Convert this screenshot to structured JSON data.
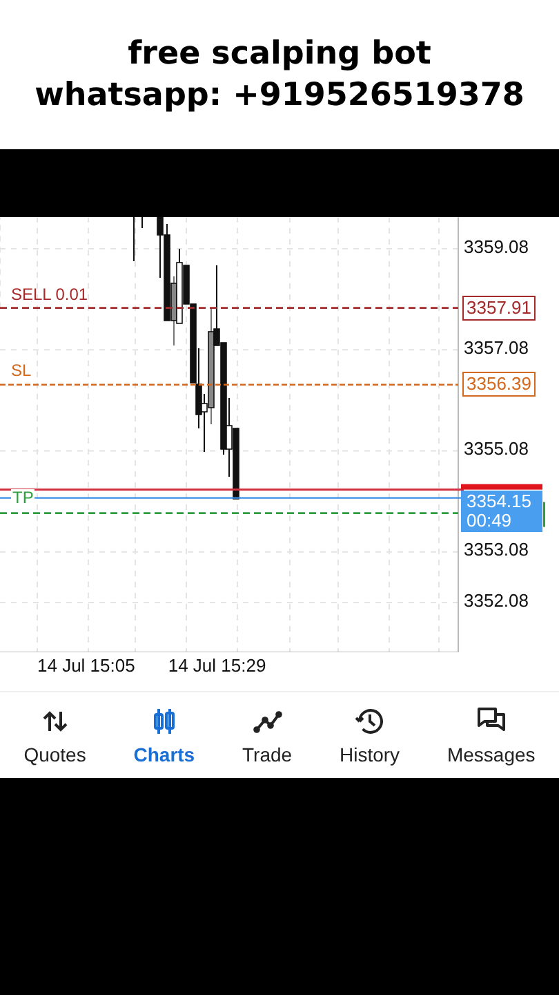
{
  "banner": {
    "lines": [
      "free scalping bot",
      "whatsapp: +919526519378"
    ]
  },
  "chart": {
    "price_ticks": [
      "3359.08",
      "3357.08",
      "3355.08",
      "3353.08",
      "3352.08"
    ],
    "time_labels": [
      "14 Jul 15:05",
      "14 Jul 15:29"
    ],
    "order_lines": [
      {
        "kind": "order",
        "label": "SELL 0.01",
        "price": "3357.91",
        "color": "#a52a2a"
      },
      {
        "kind": "stop",
        "label": "SL",
        "price": "3356.39",
        "color": "#d2691e"
      }
    ],
    "ask": {
      "price": "3354.15",
      "timer": "00:49"
    },
    "take_profit": {
      "label": "TP",
      "color": "#2e9e3e"
    }
  },
  "nav": [
    {
      "kind": "quotes",
      "label": "Quotes",
      "selected": false
    },
    {
      "kind": "charts",
      "label": "Charts",
      "selected": true
    },
    {
      "kind": "trade",
      "label": "Trade",
      "selected": false
    },
    {
      "kind": "history",
      "label": "History",
      "selected": false
    },
    {
      "kind": "messages",
      "label": "Messages",
      "selected": false
    }
  ]
}
